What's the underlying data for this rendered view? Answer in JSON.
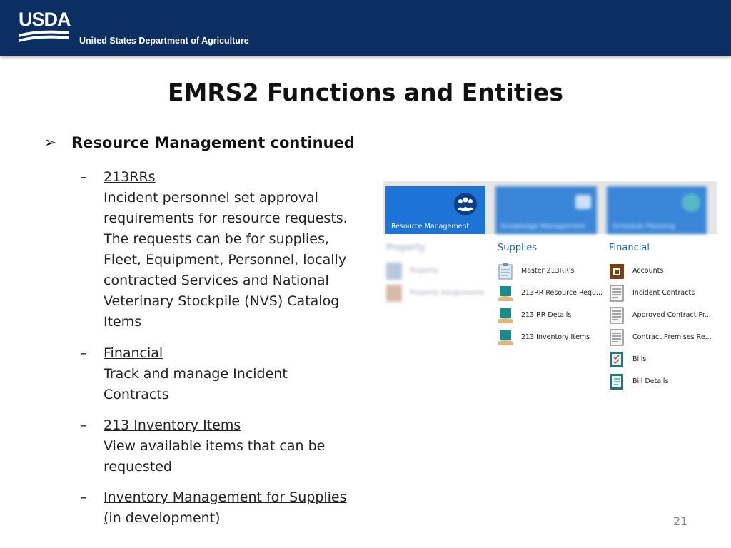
{
  "header": {
    "logo_text": "USDA",
    "department": "United States Department of Agriculture"
  },
  "title": "EMRS2 Functions and Entities",
  "bullet": {
    "text": "Resource Management continued",
    "items": [
      {
        "heading": "213RRs",
        "body": "Incident personnel set approval requirements for resource requests. The requests can be for supplies, Fleet, Equipment, Personnel, locally contracted Services and National Veterinary Stockpile (NVS) Catalog Items"
      },
      {
        "heading": "Financial",
        "body": "Track and manage Incident Contracts"
      },
      {
        "heading": "213 Inventory Items",
        "body": "View available items that can be requested"
      },
      {
        "heading": "Inventory Management for Supplies (",
        "body": "in development)"
      }
    ]
  },
  "page_number": "21",
  "screenshot": {
    "tiles": [
      {
        "label": "Resource Management"
      },
      {
        "label": "Knowledge Management"
      },
      {
        "label": "Schedule Planning"
      }
    ],
    "columns": [
      {
        "heading": "Property",
        "items": [
          "Property",
          "Property Assignments"
        ]
      },
      {
        "heading": "Supplies",
        "items": [
          "Master 213RR's",
          "213RR Resource Requ...",
          "213 RR Details",
          "213 Inventory Items"
        ]
      },
      {
        "heading": "Financial",
        "items": [
          "Accounts",
          "Incident Contracts",
          "Approved Contract Pr...",
          "Contract Premises Re...",
          "Bills",
          "Bill Details"
        ]
      }
    ]
  },
  "colors": {
    "header_bg": "#0b2f63",
    "tile_blue": "#1e74d6",
    "column_heading": "#2767b8"
  }
}
